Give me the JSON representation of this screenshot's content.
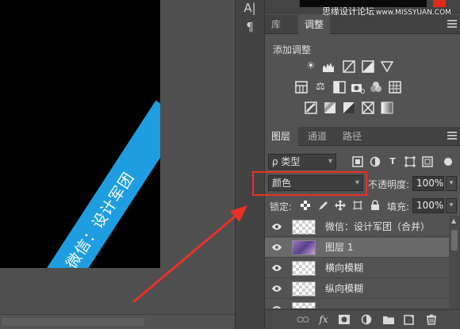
{
  "canvas": {
    "ribbon_text": "微信：设计军团"
  },
  "side_strip": {
    "icons": [
      "character-icon",
      "paragraph-icon"
    ],
    "glyphs": [
      "A|",
      "¶"
    ]
  },
  "top": {
    "watermark": "思缘设计论坛",
    "watermark_url": "www.MISSYUAN.COM"
  },
  "adjust_panel": {
    "tabs": [
      "库",
      "调整"
    ],
    "active_tab": "调整",
    "title": "添加调整",
    "icons_row1": [
      "brightness-icon",
      "levels-icon",
      "curves-icon",
      "exposure-icon",
      "vibrance-icon"
    ],
    "icons_row2": [
      "hue-saturation-icon",
      "color-balance-icon",
      "black-white-icon",
      "photo-filter-icon",
      "channel-mixer-icon",
      "color-lookup-icon"
    ],
    "icons_row3": [
      "invert-icon",
      "posterize-icon",
      "threshold-icon",
      "selective-color-icon",
      "gradient-map-icon"
    ]
  },
  "layers_panel": {
    "tabs": [
      "图层",
      "通道",
      "路径"
    ],
    "active_tab": "图层",
    "filter_kind": "ρ 类型",
    "blend_mode": "颜色",
    "opacity_label": "不透明度:",
    "opacity_value": "100%",
    "lock_label": "锁定:",
    "fill_label": "填充:",
    "fill_value": "100%",
    "layers": [
      {
        "name": "微信：设计军团（合并）",
        "selected": false,
        "thumb": "transparent"
      },
      {
        "name": "图层 1",
        "selected": true,
        "thumb": "photo"
      },
      {
        "name": "横向模糊",
        "selected": false,
        "thumb": "transparent"
      },
      {
        "name": "纵向模糊",
        "selected": false,
        "thumb": "transparent"
      },
      {
        "name": "",
        "selected": false,
        "thumb": "transparent"
      }
    ],
    "bottom_icons": [
      "link-icon",
      "fx-icon",
      "mask-icon",
      "adjustment-icon",
      "group-folder-icon",
      "new-layer-icon",
      "trash-icon"
    ]
  },
  "colors": {
    "ribbon_blue": "#1e9ee0",
    "highlight_red": "#e8322a",
    "panel_bg": "#535353"
  }
}
